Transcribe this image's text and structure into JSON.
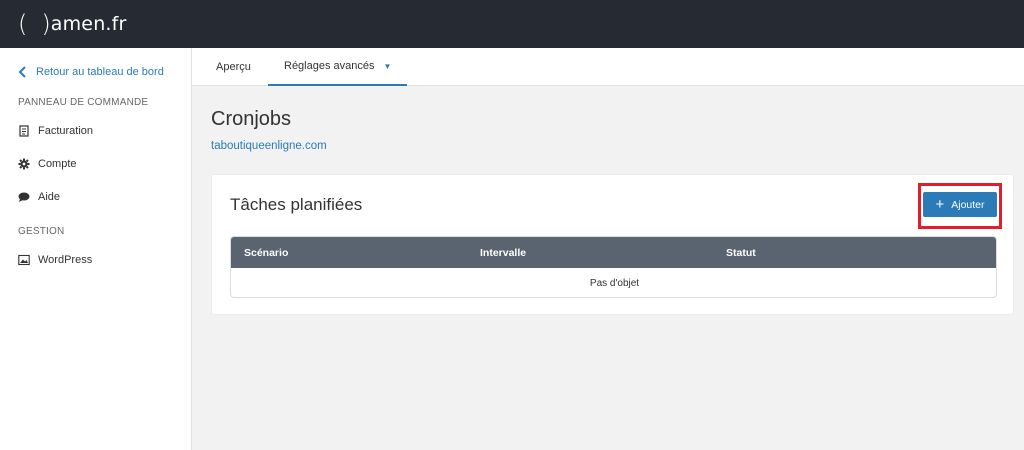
{
  "brand": {
    "name": "amen.fr"
  },
  "sidebar": {
    "back_label": "Retour au tableau de bord",
    "sections": [
      {
        "title": "PANNEAU DE COMMANDE",
        "items": [
          {
            "label": "Facturation",
            "icon": "invoice-icon"
          },
          {
            "label": "Compte",
            "icon": "gear-icon"
          },
          {
            "label": "Aide",
            "icon": "chat-bubble-icon"
          }
        ]
      },
      {
        "title": "GESTION",
        "items": [
          {
            "label": "WordPress",
            "icon": "image-icon"
          }
        ]
      }
    ]
  },
  "tabs": [
    {
      "label": "Aperçu",
      "active": false
    },
    {
      "label": "Réglages avancés",
      "active": true,
      "has_caret": true
    }
  ],
  "main": {
    "title": "Cronjobs",
    "domain": "taboutiqueenligne.com",
    "card": {
      "title": "Tâches planifiées",
      "add_button": "Ajouter",
      "table": {
        "columns": [
          "Scénario",
          "Intervalle",
          "Statut"
        ],
        "empty_message": "Pas d'objet"
      }
    }
  },
  "colors": {
    "topbar": "#262a32",
    "accent": "#2b7bb9",
    "table_header": "#5a6470",
    "highlight": "#e01f2b"
  }
}
